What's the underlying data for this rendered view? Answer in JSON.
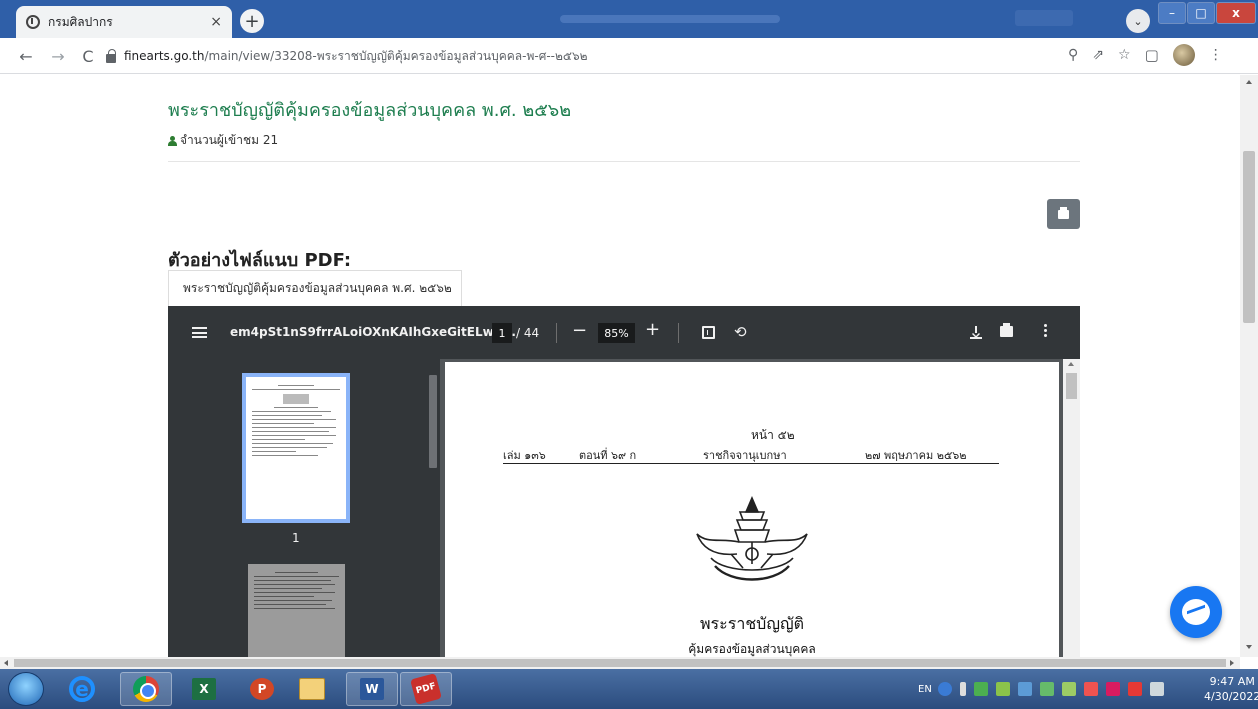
{
  "browser": {
    "tab_title": "กรมศิลปากร",
    "tab_close": "×",
    "new_tab": "+",
    "url_host": "finearts.go.th",
    "url_path": "/main/view/33208-พระราชบัญญัติคุ้มครองข้อมูลส่วนบุคคล-พ-ศ--๒๕๖๒"
  },
  "page": {
    "title": "พระราชบัญญัติคุ้มครองข้อมูลส่วนบุคคล พ.ศ. ๒๕๖๒",
    "views_label": "จำนวนผู้เข้าชม 21",
    "section_heading": "ตัวอย่างไฟล์แนบ PDF:",
    "file_tab_label": "พระราชบัญญัติคุ้มครองข้อมูลส่วนบุคคล พ.ศ. ๒๕๖๒"
  },
  "pdf_viewer": {
    "file_name": "em4pSt1nS9frrALoiOXnKAIhGxeGitELwh...",
    "current_page": "1",
    "total_pages": "/ 44",
    "zoom": "85%",
    "zoom_minus": "−",
    "zoom_plus": "+",
    "thumbnail_label": "1"
  },
  "gazette": {
    "page_no": "หน้า ๕๒",
    "volume": "เล่ม ๑๓๖",
    "section": "ตอนที่ ๖๙ ก",
    "publication": "ราชกิจจานุเบกษา",
    "date": "๒๗ พฤษภาคม ๒๕๖๒",
    "law_title": "พระราชบัญญัติ",
    "law_subtitle": "คุ้มครองข้อมูลส่วนบุคคล"
  },
  "taskbar": {
    "pdf_app": "PDF",
    "lang": "EN",
    "time": "9:47 AM",
    "date": "4/30/2022"
  },
  "colors": {
    "title_green": "#1e7e4f",
    "titlebar_blue": "#2f5fa8",
    "pdf_toolbar": "#323639",
    "messenger_blue": "#1877f2"
  }
}
